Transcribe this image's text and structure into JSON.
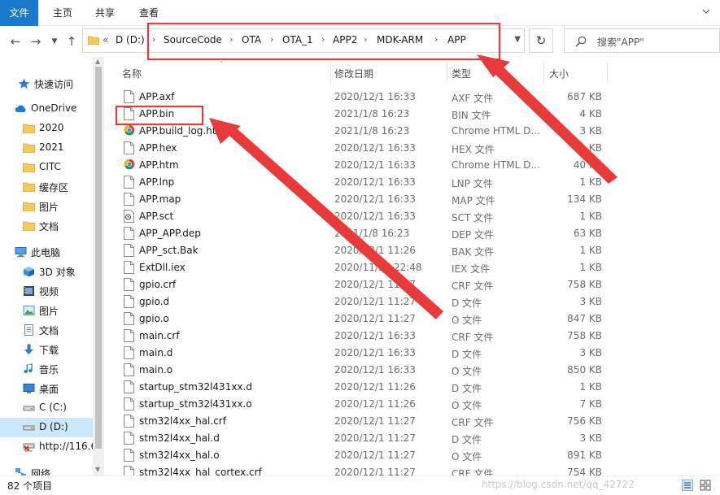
{
  "ribbon": {
    "tabs": [
      "文件",
      "主页",
      "共享",
      "查看"
    ]
  },
  "address": {
    "segments": [
      "D (D:)",
      "SourceCode",
      "OTA",
      "OTA_1",
      "APP2",
      "MDK-ARM",
      "APP"
    ],
    "overflow_glyph": "«"
  },
  "search": {
    "placeholder": "搜索\"APP\""
  },
  "sidebar": {
    "items": [
      {
        "label": "快速访问",
        "icon": "star-icon"
      },
      {
        "label": "OneDrive",
        "icon": "cloud-icon"
      },
      {
        "label": "2020",
        "icon": "folder-icon"
      },
      {
        "label": "2021",
        "icon": "folder-icon"
      },
      {
        "label": "CITC",
        "icon": "folder-icon"
      },
      {
        "label": "缓存区",
        "icon": "folder-icon"
      },
      {
        "label": "图片",
        "icon": "folder-icon"
      },
      {
        "label": "文档",
        "icon": "folder-icon"
      },
      {
        "label": "此电脑",
        "icon": "computer-icon"
      },
      {
        "label": "3D 对象",
        "icon": "cube-icon"
      },
      {
        "label": "视频",
        "icon": "video-icon"
      },
      {
        "label": "图片",
        "icon": "pictures-icon"
      },
      {
        "label": "文档",
        "icon": "documents-icon"
      },
      {
        "label": "下载",
        "icon": "download-icon"
      },
      {
        "label": "音乐",
        "icon": "music-icon"
      },
      {
        "label": "桌面",
        "icon": "desktop-icon"
      },
      {
        "label": "C (C:)",
        "icon": "drive-icon"
      },
      {
        "label": "D (D:)",
        "icon": "drive-icon",
        "selected": true
      },
      {
        "label": "http://116.6",
        "icon": "network-drive-icon"
      },
      {
        "label": "网络",
        "icon": "network-icon"
      }
    ]
  },
  "columns": {
    "name": "名称",
    "date": "修改日期",
    "type": "类型",
    "size": "大小"
  },
  "files": [
    {
      "name": "APP.axf",
      "date": "2020/12/1 16:33",
      "type": "AXF 文件",
      "size": "687 KB",
      "icon": "file-icon"
    },
    {
      "name": "APP.bin",
      "date": "2021/1/8 16:23",
      "type": "BIN 文件",
      "size": "4 KB",
      "icon": "file-icon"
    },
    {
      "name": "APP.build_log.htm",
      "date": "2021/1/8 16:23",
      "type": "Chrome HTML D...",
      "size": "3 KB",
      "icon": "chrome-icon"
    },
    {
      "name": "APP.hex",
      "date": "2020/12/1 16:33",
      "type": "HEX 文件",
      "size": "11 KB",
      "icon": "file-icon"
    },
    {
      "name": "APP.htm",
      "date": "2020/12/1 16:33",
      "type": "Chrome HTML D...",
      "size": "40 KB",
      "icon": "chrome-icon"
    },
    {
      "name": "APP.lnp",
      "date": "2020/12/1 16:33",
      "type": "LNP 文件",
      "size": "1 KB",
      "icon": "file-icon"
    },
    {
      "name": "APP.map",
      "date": "2020/12/1 16:33",
      "type": "MAP 文件",
      "size": "134 KB",
      "icon": "file-icon"
    },
    {
      "name": "APP.sct",
      "date": "2020/12/1 16:33",
      "type": "SCT 文件",
      "size": "1 KB",
      "icon": "script-file-icon"
    },
    {
      "name": "APP_APP.dep",
      "date": "2021/1/8 16:23",
      "type": "DEP 文件",
      "size": "63 KB",
      "icon": "file-icon"
    },
    {
      "name": "APP_sct.Bak",
      "date": "2020/12/1 11:26",
      "type": "BAK 文件",
      "size": "1 KB",
      "icon": "file-icon"
    },
    {
      "name": "ExtDll.iex",
      "date": "2020/11/30 22:48",
      "type": "IEX 文件",
      "size": "1 KB",
      "icon": "file-icon"
    },
    {
      "name": "gpio.crf",
      "date": "2020/12/1 11:27",
      "type": "CRF 文件",
      "size": "758 KB",
      "icon": "file-icon"
    },
    {
      "name": "gpio.d",
      "date": "2020/12/1 11:27",
      "type": "D 文件",
      "size": "3 KB",
      "icon": "file-icon"
    },
    {
      "name": "gpio.o",
      "date": "2020/12/1 11:27",
      "type": "O 文件",
      "size": "847 KB",
      "icon": "file-icon"
    },
    {
      "name": "main.crf",
      "date": "2020/12/1 16:33",
      "type": "CRF 文件",
      "size": "758 KB",
      "icon": "file-icon"
    },
    {
      "name": "main.d",
      "date": "2020/12/1 16:33",
      "type": "D 文件",
      "size": "3 KB",
      "icon": "file-icon"
    },
    {
      "name": "main.o",
      "date": "2020/12/1 16:33",
      "type": "O 文件",
      "size": "850 KB",
      "icon": "file-icon"
    },
    {
      "name": "startup_stm32l431xx.d",
      "date": "2020/12/1 11:26",
      "type": "D 文件",
      "size": "1 KB",
      "icon": "file-icon"
    },
    {
      "name": "startup_stm32l431xx.o",
      "date": "2020/12/1 11:26",
      "type": "O 文件",
      "size": "7 KB",
      "icon": "file-icon"
    },
    {
      "name": "stm32l4xx_hal.crf",
      "date": "2020/12/1 11:27",
      "type": "CRF 文件",
      "size": "756 KB",
      "icon": "file-icon"
    },
    {
      "name": "stm32l4xx_hal.d",
      "date": "2020/12/1 11:27",
      "type": "D 文件",
      "size": "3 KB",
      "icon": "file-icon"
    },
    {
      "name": "stm32l4xx_hal.o",
      "date": "2020/12/1 11:27",
      "type": "O 文件",
      "size": "891 KB",
      "icon": "file-icon"
    },
    {
      "name": "stm32l4xx_hal_cortex.crf",
      "date": "2020/12/1 11:27",
      "type": "CRF 文件",
      "size": "754 KB",
      "icon": "file-icon"
    }
  ],
  "status": {
    "item_count": "82 个项目"
  },
  "watermark": "https://blog.csdn.net/qq_42722",
  "colors": {
    "file_tab": "#1979ca",
    "selection": "#cce8ff",
    "annotation": "#e83a3a"
  },
  "annotations": {
    "highlighted": [
      "address-path",
      "APP.bin"
    ]
  }
}
